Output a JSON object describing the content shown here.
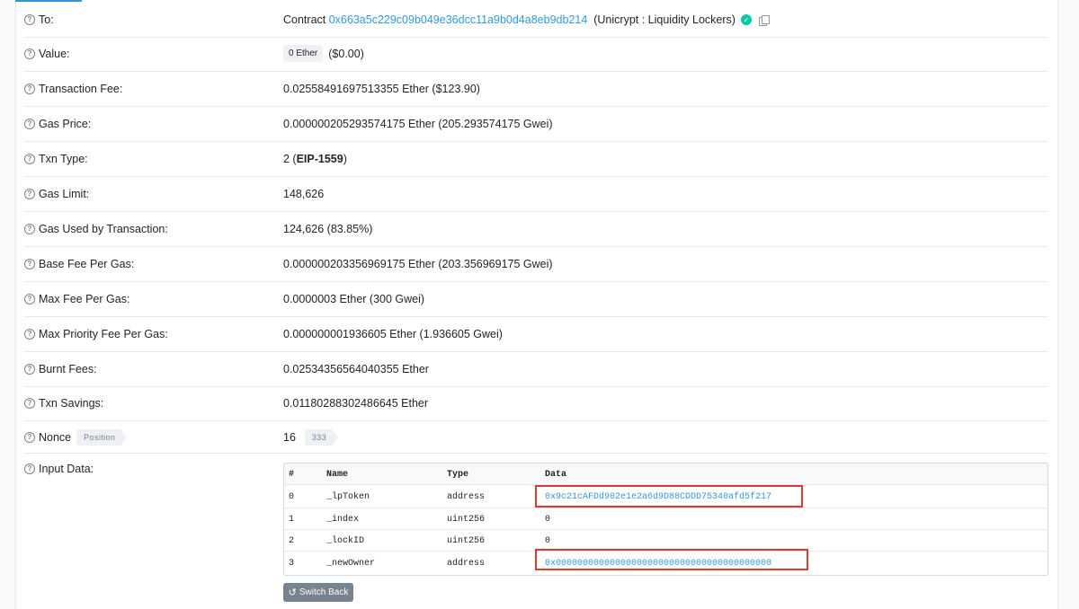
{
  "rows": [
    {
      "label": "To:",
      "prefix": "Contract",
      "address": "0x663a5c229c09b049e36dcc11a9b0d4a8eb9db214",
      "name": "(Unicrypt : Liquidity Lockers)"
    },
    {
      "label": "Value:",
      "pill": "0 Ether",
      "usd": "($0.00)"
    },
    {
      "label": "Transaction Fee:",
      "value": "0.02558491697513355 Ether ($123.90)"
    },
    {
      "label": "Gas Price:",
      "value": "0.000000205293574175 Ether (205.293574175 Gwei)"
    },
    {
      "label": "Txn Type:",
      "value_prefix": "2 (",
      "value_bold": "EIP-1559",
      "value_suffix": ")"
    },
    {
      "label": "Gas Limit:",
      "value": "148,626"
    },
    {
      "label": "Gas Used by Transaction:",
      "value": "124,626 (83.85%)"
    },
    {
      "label": "Base Fee Per Gas:",
      "value": "0.000000203356969175 Ether (203.356969175 Gwei)"
    },
    {
      "label": "Max Fee Per Gas:",
      "value": "0.0000003 Ether (300 Gwei)"
    },
    {
      "label": "Max Priority Fee Per Gas:",
      "value": "0.000000001936605 Ether (1.936605 Gwei)"
    },
    {
      "label": "Burnt Fees:",
      "value": "0.02534356564040355 Ether"
    },
    {
      "label": "Txn Savings:",
      "value": "0.01180288302486645 Ether"
    },
    {
      "label": "Nonce",
      "tag": "Position",
      "value": "16",
      "position": "333"
    },
    {
      "label": "Input Data:"
    }
  ],
  "input_table": {
    "headers": [
      "#",
      "Name",
      "Type",
      "Data"
    ],
    "rows": [
      {
        "idx": "0",
        "name": "_lpToken",
        "type": "address",
        "data": "0x9c21cAFDd902e1e2a6d9D88CDDD75340afd5f217"
      },
      {
        "idx": "1",
        "name": "_index",
        "type": "uint256",
        "data": "0"
      },
      {
        "idx": "2",
        "name": "_lockID",
        "type": "uint256",
        "data": "0"
      },
      {
        "idx": "3",
        "name": "_newOwner",
        "type": "address",
        "data": "0x0000000000000000000000000000000000000000"
      }
    ]
  },
  "switch_back_label": "Switch Back",
  "icons": {
    "help": "question-circle-icon",
    "verified": "check-circle-icon",
    "copy": "copy-icon",
    "undo": "undo-icon"
  },
  "colors": {
    "link": "#3498db",
    "verified": "#00c9a7",
    "highlight": "#e03a2f"
  }
}
